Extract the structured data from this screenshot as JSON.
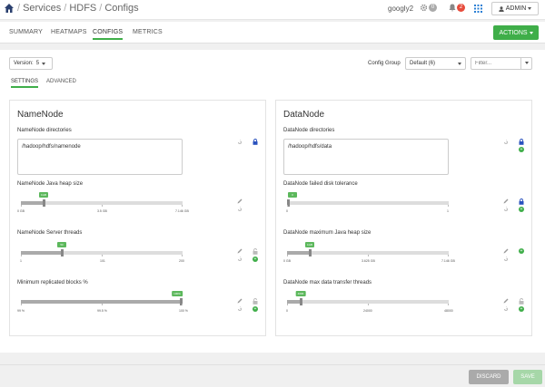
{
  "breadcrumb": {
    "root": "Services",
    "service": "HDFS",
    "page": "Configs"
  },
  "header": {
    "user": "googly2",
    "settings_count": "0",
    "alerts_count": "2",
    "admin_label": "ADMIN"
  },
  "tabs": [
    "SUMMARY",
    "HEATMAPS",
    "CONFIGS",
    "METRICS"
  ],
  "actions_label": "ACTIONS",
  "version": {
    "label": "Version:",
    "value": "5"
  },
  "config_group": {
    "label": "Config Group",
    "value": "Default (6)"
  },
  "filter": {
    "placeholder": "Filter..."
  },
  "subtabs": [
    "SETTINGS",
    "ADVANCED"
  ],
  "namenode": {
    "title": "NameNode",
    "dirs_label": "NameNode directories",
    "dirs_value": "/hadoop/hdfs/namenode",
    "heap": {
      "label": "NameNode Java heap size",
      "value_label": "1GB",
      "fraction": 0.14,
      "ticks": [
        "0 GB",
        "3.5 GB",
        "7.146 GB"
      ]
    },
    "threads": {
      "label": "NameNode Server threads",
      "value_label": "50",
      "fraction": 0.25,
      "ticks": [
        "1",
        "101",
        "200"
      ]
    },
    "min_blocks": {
      "label": "Minimum replicated blocks %",
      "value_label": "100%",
      "fraction": 1.0,
      "ticks": [
        "99 %",
        "99.5 %",
        "100 %"
      ]
    }
  },
  "datanode": {
    "title": "DataNode",
    "dirs_label": "DataNode directories",
    "dirs_value": "/hadoop/hdfs/data",
    "failed": {
      "label": "DataNode failed disk tolerance",
      "value_label": "0",
      "fraction": 0.0,
      "ticks": [
        "0",
        "1"
      ]
    },
    "heap": {
      "label": "DataNode maximum Java heap size",
      "value_label": "1GB",
      "fraction": 0.14,
      "ticks": [
        "0 GB",
        "3.625 GB",
        "7.146 GB"
      ]
    },
    "transfer": {
      "label": "DataNode max data transfer threads",
      "value_label": "4096",
      "fraction": 0.085,
      "ticks": [
        "0",
        "24000",
        "48000"
      ]
    }
  },
  "footer": {
    "discard_label": "DISCARD",
    "save_label": "SAVE"
  },
  "colors": {
    "accent": "#3fae49",
    "alert": "#e74c3c",
    "lock": "#2a52be"
  }
}
